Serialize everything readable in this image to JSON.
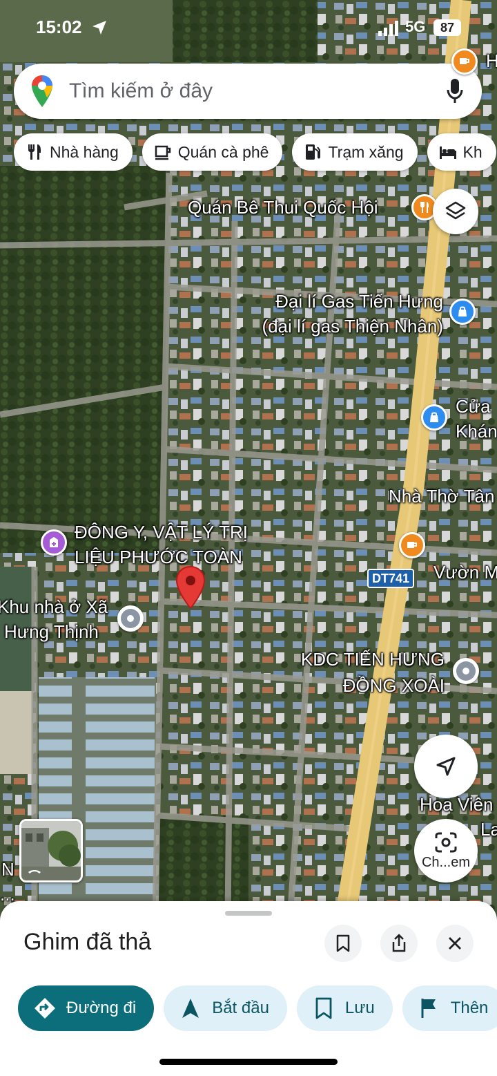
{
  "status_bar": {
    "time": "15:02",
    "network": "5G",
    "battery": "87"
  },
  "search": {
    "placeholder": "Tìm kiếm ở đây"
  },
  "chips": [
    {
      "label": "Nhà hàng",
      "icon": "fork-knife-icon"
    },
    {
      "label": "Quán cà phê",
      "icon": "coffee-cup-icon"
    },
    {
      "label": "Trạm xăng",
      "icon": "gas-pump-icon"
    },
    {
      "label": "Kh",
      "icon": "bed-icon"
    }
  ],
  "map": {
    "labels": {
      "top_right_partial": "H",
      "be_thui": "Quán Bê Thui Quốc Hội",
      "gas_line1": "Đại lí Gas Tiến Hưng",
      "gas_line2": "(đại lí gas Thiện Nhân)",
      "cua_line1": "Cửa",
      "cua_line2": "Khán",
      "nha_tho": "Nhà Thờ Tân",
      "dong_y_line1": "ĐÔNG Y, VẬT LÝ TRỊ",
      "dong_y_line2": "LIỆU PHƯỚC TOÀN",
      "vuon": "Vườn M",
      "khu_nha_line1": "Khu nhà ở Xã",
      "khu_nha_line2": "Hưng Thịnh",
      "kdc_line1": "KDC TIẾN HƯNG",
      "kdc_line2": "ĐỒNG XOÀI",
      "hoa_vien_line1": "Hoa Viên",
      "hoa_vien_line2": "La",
      "left_n": "N",
      "left_dots": "..."
    },
    "road_shield": "DT741",
    "lens_caption": "Ch...em"
  },
  "sheet": {
    "title": "Ghim đã thả",
    "actions": [
      {
        "label": "Đường đi",
        "icon": "directions-icon"
      },
      {
        "label": "Bắt đầu",
        "icon": "navigation-arrow-icon"
      },
      {
        "label": "Lưu",
        "icon": "bookmark-icon"
      },
      {
        "label": "Thên",
        "icon": "flag-icon"
      }
    ]
  },
  "colors": {
    "primary_action": "#0b6e7a",
    "secondary_action_bg": "#dff0f8",
    "pin_red": "#e53935",
    "road_yellow": "#e7c877"
  }
}
